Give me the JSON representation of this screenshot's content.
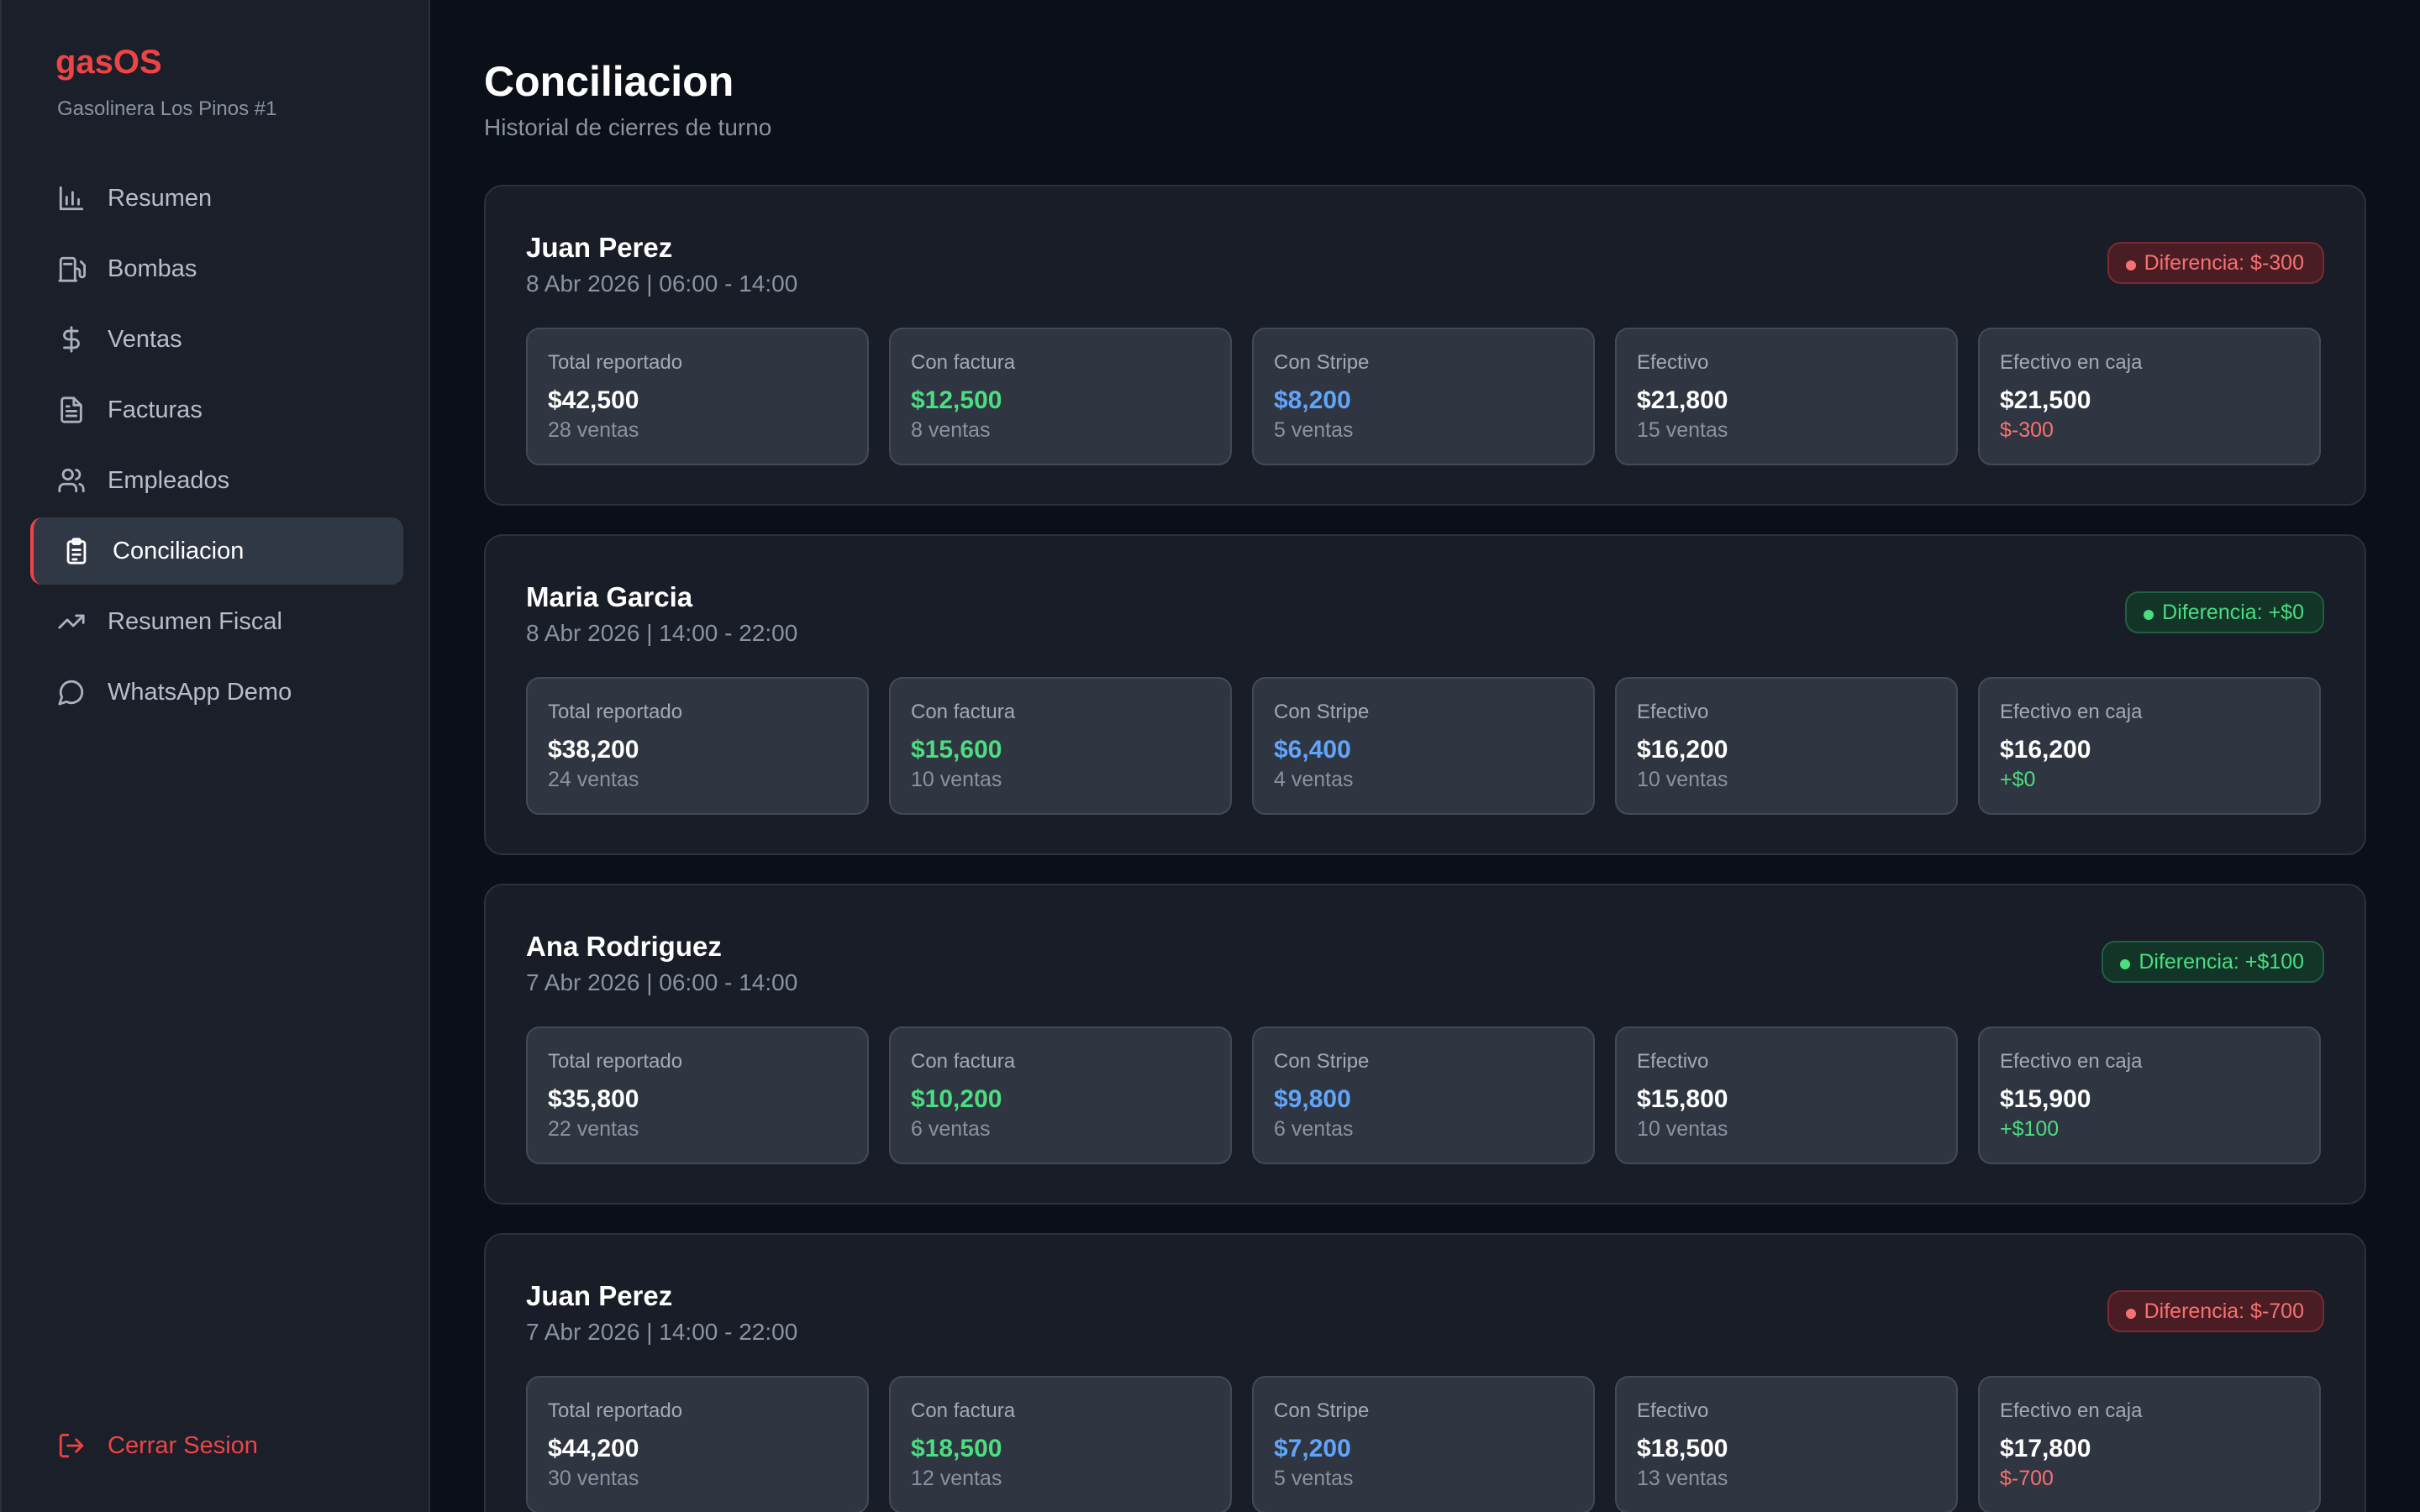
{
  "app": {
    "brand": "gasOS",
    "station": "Gasolinera Los Pinos #1"
  },
  "sidebar": {
    "items": [
      {
        "label": "Resumen",
        "icon": "bar-chart-icon"
      },
      {
        "label": "Bombas",
        "icon": "fuel-pump-icon"
      },
      {
        "label": "Ventas",
        "icon": "dollar-icon"
      },
      {
        "label": "Facturas",
        "icon": "document-icon"
      },
      {
        "label": "Empleados",
        "icon": "users-icon"
      },
      {
        "label": "Conciliacion",
        "icon": "clipboard-icon",
        "active": true
      },
      {
        "label": "Resumen Fiscal",
        "icon": "trending-up-icon"
      },
      {
        "label": "WhatsApp Demo",
        "icon": "chat-bubble-icon"
      }
    ],
    "logout": "Cerrar Sesion"
  },
  "page": {
    "title": "Conciliacion",
    "subtitle": "Historial de cierres de turno"
  },
  "labels": {
    "total": "Total reportado",
    "factura": "Con factura",
    "stripe": "Con Stripe",
    "efectivo": "Efectivo",
    "caja": "Efectivo en caja"
  },
  "shifts": [
    {
      "name": "Juan Perez",
      "date": "8 Abr 2026 | 06:00 - 14:00",
      "badge": "Diferencia: $-300",
      "status": "neg",
      "total": "$42,500",
      "total_sub": "28 ventas",
      "factura": "$12,500",
      "factura_sub": "8 ventas",
      "stripe": "$8,200",
      "stripe_sub": "5 ventas",
      "efectivo": "$21,800",
      "efectivo_sub": "15 ventas",
      "caja": "$21,500",
      "caja_sub": "$-300"
    },
    {
      "name": "Maria Garcia",
      "date": "8 Abr 2026 | 14:00 - 22:00",
      "badge": "Diferencia: +$0",
      "status": "pos",
      "total": "$38,200",
      "total_sub": "24 ventas",
      "factura": "$15,600",
      "factura_sub": "10 ventas",
      "stripe": "$6,400",
      "stripe_sub": "4 ventas",
      "efectivo": "$16,200",
      "efectivo_sub": "10 ventas",
      "caja": "$16,200",
      "caja_sub": "+$0"
    },
    {
      "name": "Ana Rodriguez",
      "date": "7 Abr 2026 | 06:00 - 14:00",
      "badge": "Diferencia: +$100",
      "status": "pos",
      "total": "$35,800",
      "total_sub": "22 ventas",
      "factura": "$10,200",
      "factura_sub": "6 ventas",
      "stripe": "$9,800",
      "stripe_sub": "6 ventas",
      "efectivo": "$15,800",
      "efectivo_sub": "10 ventas",
      "caja": "$15,900",
      "caja_sub": "+$100"
    },
    {
      "name": "Juan Perez",
      "date": "7 Abr 2026 | 14:00 - 22:00",
      "badge": "Diferencia: $-700",
      "status": "neg",
      "total": "$44,200",
      "total_sub": "30 ventas",
      "factura": "$18,500",
      "factura_sub": "12 ventas",
      "stripe": "$7,200",
      "stripe_sub": "5 ventas",
      "efectivo": "$18,500",
      "efectivo_sub": "13 ventas",
      "caja": "$17,800",
      "caja_sub": "$-700"
    }
  ],
  "colors": {
    "accent": "#ef4444",
    "positive": "#4ade80",
    "stripe": "#60a5fa"
  }
}
